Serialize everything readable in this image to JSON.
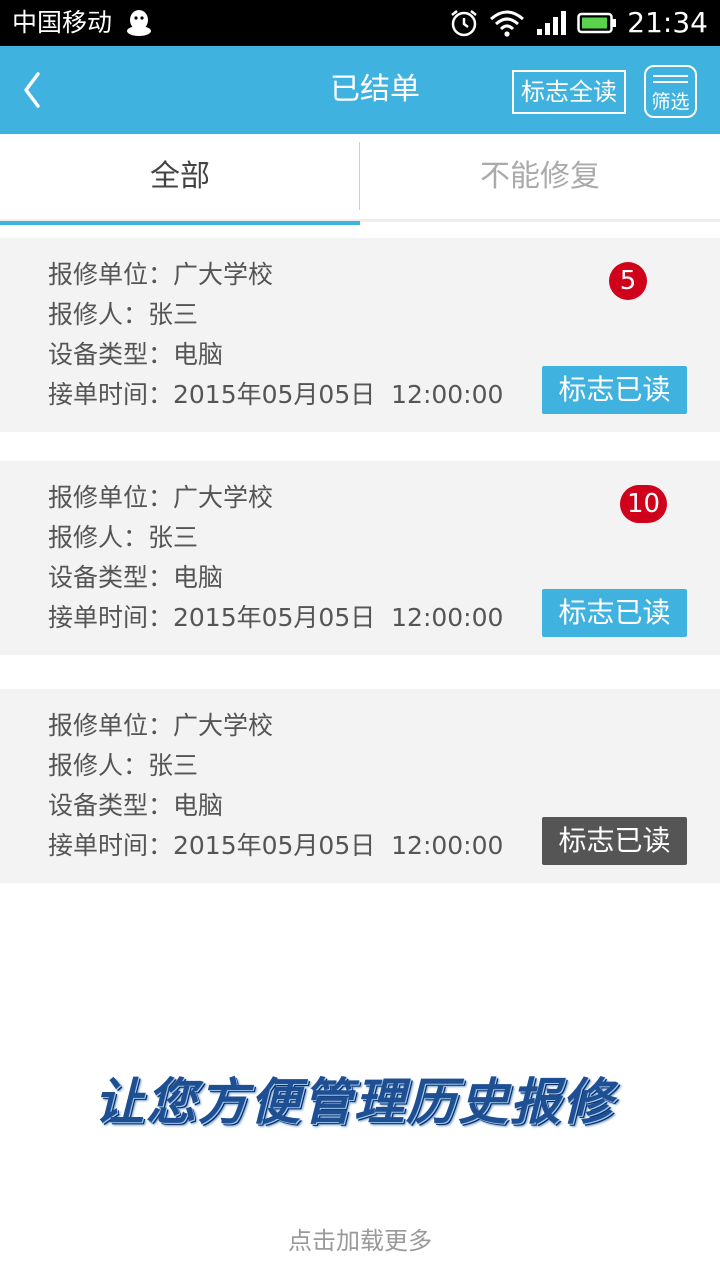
{
  "status_bar": {
    "carrier": "中国移动",
    "time": "21:34",
    "icons": [
      "qq-icon",
      "alarm-icon",
      "wifi-icon",
      "signal-icon",
      "battery-icon"
    ]
  },
  "header": {
    "title": "已结单",
    "mark_all_label": "标志全读",
    "filter_label": "筛选",
    "accent_color": "#3fb2e0"
  },
  "tabs": [
    {
      "label": "全部",
      "active": true
    },
    {
      "label": "不能修复",
      "active": false
    }
  ],
  "orders": [
    {
      "unit": "报修单位：广大学校",
      "reporter": "报修人：张三",
      "device": "设备类型：电脑",
      "time": "接单时间：2015年05月05日  12:00:00",
      "badge": "5",
      "button_label": "标志已读",
      "read": false
    },
    {
      "unit": "报修单位：广大学校",
      "reporter": "报修人：张三",
      "device": "设备类型：电脑",
      "time": "接单时间：2015年05月05日  12:00:00",
      "badge": "10",
      "button_label": "标志已读",
      "read": false
    },
    {
      "unit": "报修单位：广大学校",
      "reporter": "报修人：张三",
      "device": "设备类型：电脑",
      "time": "接单时间：2015年05月05日  12:00:00",
      "badge": "",
      "button_label": "标志已读",
      "read": true
    }
  ],
  "slogan": "让您方便管理历史报修",
  "load_more": "点击加载更多"
}
